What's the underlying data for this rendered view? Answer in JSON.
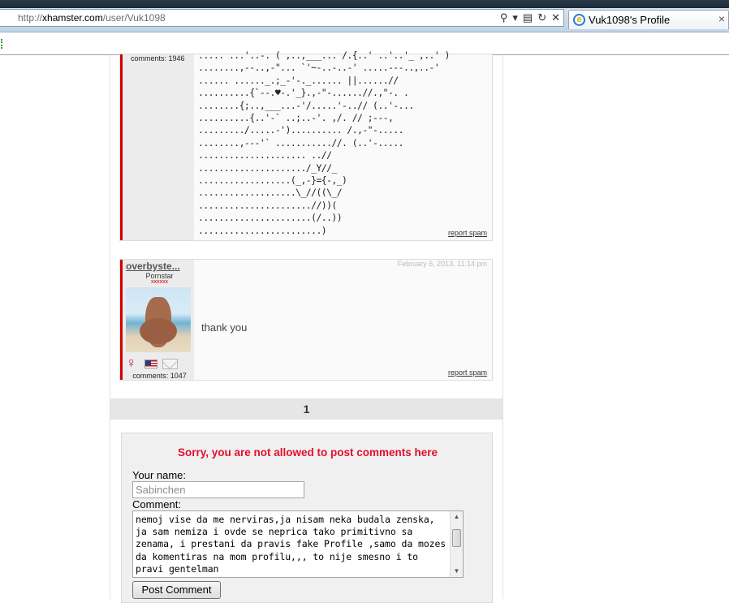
{
  "browser": {
    "url_prefix": "http://",
    "url_domain": "xhamster.com",
    "url_path": "/user/Vuk1098",
    "tab_title": "Vuk1098's Profile",
    "tab_close": "×",
    "icons": [
      "search-icon",
      "dropdown-icon",
      "compat-view-icon",
      "refresh-icon",
      "stop-icon"
    ]
  },
  "comment1": {
    "count_label": "comments: 1946",
    "ascii_lines": [
      "..... ...'..-. ( ,..,___... /.{..' ..'..'_ ,..' )",
      "........,--..,-\"... `'~-..-..-' .....---..,..-'",
      "...... ......_.;_-'-._...... ||......//",
      "..........{`--.♥-.'_}.,-\"-......//.,\"-. .",
      "........{;..,___...-'/.....'-..// (..'-...",
      "..........{..'-` ..;..-'. ,/. // ;---,",
      "........./.....-').......... /.,-\"-.....",
      "........,---'` ...........//. (..'-.....",
      "..................... ..//",
      "...................../_Y//_",
      "..................(_,-}={-,_)",
      "...................\\_//((\\_/",
      "......................//))(",
      "......................(/..))",
      "........................)"
    ],
    "report": "report spam"
  },
  "comment2": {
    "username": "overbyste...",
    "role": "Pornstar",
    "stars": "xxxxxx",
    "count_label": "comments: 1047",
    "date": "February 6, 2013, 11:14 pm",
    "text": "thank you",
    "report": "report spam"
  },
  "pager": {
    "current": "1"
  },
  "form": {
    "notice": "Sorry, you are not allowed to post comments here",
    "name_label": "Your name:",
    "name_value": "Sabinchen",
    "comment_label": "Comment:",
    "comment_text": "nemoj vise da me nerviras,ja nisam neka budala zenska, ja sam nemiza i ovde se neprica tako primitivno sa zenama, i prestani da pravis fake Profile ,samo da mozes da komentiras na mom profilu,,, to nije smesno i to pravi gentelman",
    "submit_label": "Post Comment"
  },
  "colors": {
    "accent_red": "#e2102e",
    "sidebar_bar": "#d20000"
  }
}
